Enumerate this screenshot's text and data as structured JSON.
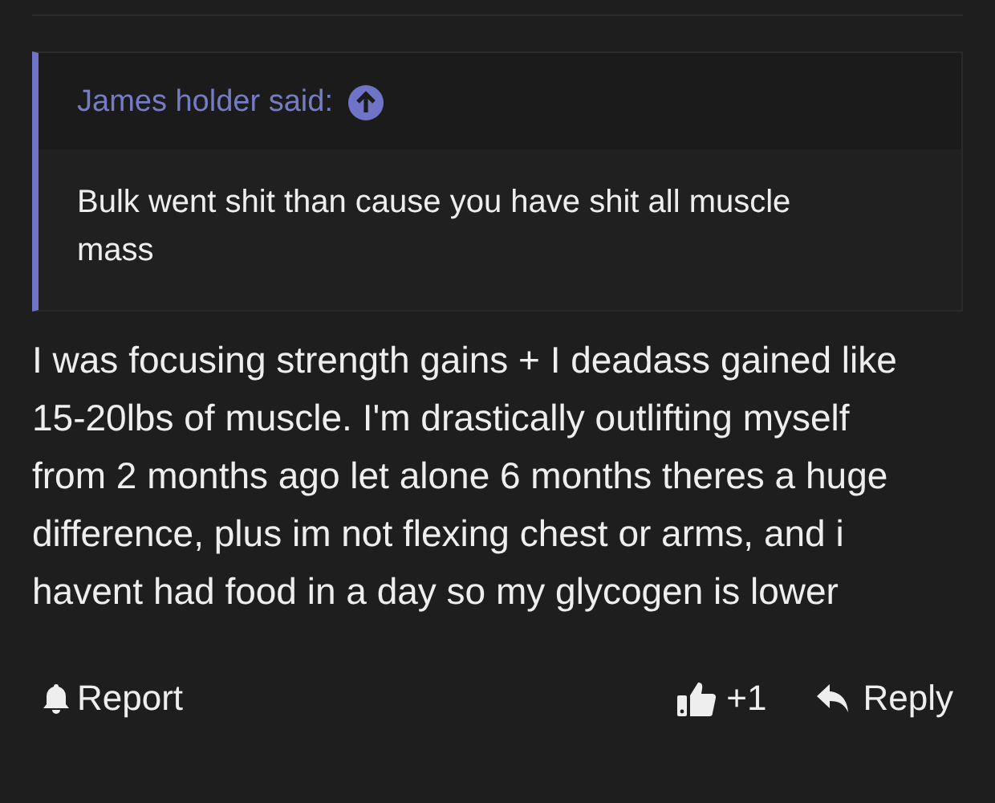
{
  "quote": {
    "author": "James holder said:",
    "text": "Bulk went shit than cause you have shit all muscle mass"
  },
  "message": "I was focusing strength gains + I deadass gained like 15-20lbs of muscle. I'm drastically outlifting myself from 2 months ago let alone 6 months theres a huge difference, plus im not flexing chest or arms, and i havent had food in a day so my glycogen is lower",
  "actions": {
    "report": "Report",
    "reactions": "+1",
    "reply": "Reply"
  }
}
